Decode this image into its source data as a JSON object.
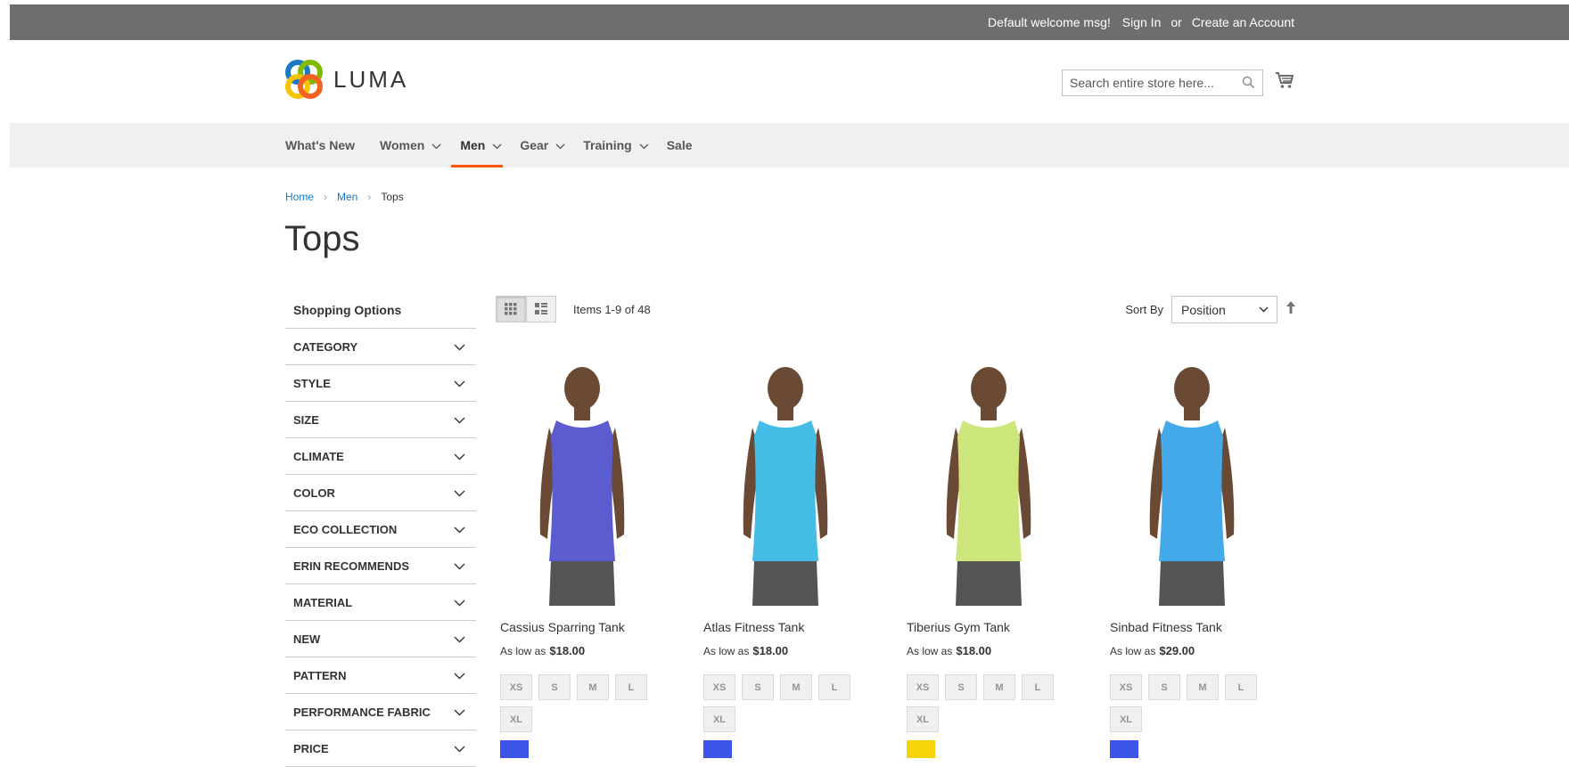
{
  "topbar": {
    "welcome": "Default welcome msg!",
    "sign_in": "Sign In",
    "or": "or",
    "create_account": "Create an Account"
  },
  "header": {
    "logo_text": "LUMA",
    "search_placeholder": "Search entire store here..."
  },
  "nav": {
    "items": [
      {
        "label": "What's New",
        "has_chevron": false
      },
      {
        "label": "Women",
        "has_chevron": true
      },
      {
        "label": "Men",
        "has_chevron": true,
        "active": true
      },
      {
        "label": "Gear",
        "has_chevron": true
      },
      {
        "label": "Training",
        "has_chevron": true
      },
      {
        "label": "Sale",
        "has_chevron": false
      }
    ],
    "active_color": "#ff5501"
  },
  "breadcrumb": {
    "items": [
      "Home",
      "Men",
      "Tops"
    ],
    "separator": "›"
  },
  "page": {
    "title": "Tops"
  },
  "sidebar": {
    "title": "Shopping Options",
    "filters": [
      "CATEGORY",
      "STYLE",
      "SIZE",
      "CLIMATE",
      "COLOR",
      "ECO COLLECTION",
      "ERIN RECOMMENDS",
      "MATERIAL",
      "NEW",
      "PATTERN",
      "PERFORMANCE FABRIC",
      "PRICE"
    ]
  },
  "toolbar": {
    "amount": "Items 1-9 of 48",
    "sort_label": "Sort By",
    "sort_value": "Position"
  },
  "products": [
    {
      "name": "Cassius Sparring Tank",
      "price_prefix": "As low as",
      "price": "$18.00",
      "sizes": [
        "XS",
        "S",
        "M",
        "L",
        "XL"
      ],
      "shirt_color": "#5a5ccf",
      "swatch": "#3c55e8"
    },
    {
      "name": "Atlas Fitness Tank",
      "price_prefix": "As low as",
      "price": "$18.00",
      "sizes": [
        "XS",
        "S",
        "M",
        "L",
        "XL"
      ],
      "shirt_color": "#46bde6",
      "swatch": "#3c55e8"
    },
    {
      "name": "Tiberius Gym Tank",
      "price_prefix": "As low as",
      "price": "$18.00",
      "sizes": [
        "XS",
        "S",
        "M",
        "L",
        "XL"
      ],
      "shirt_color": "#cde67c",
      "swatch": "#f5d40a"
    },
    {
      "name": "Sinbad Fitness Tank",
      "price_prefix": "As low as",
      "price": "$29.00",
      "sizes": [
        "XS",
        "S",
        "M",
        "L",
        "XL"
      ],
      "shirt_color": "#44a9e8",
      "swatch": "#3c55e8"
    }
  ]
}
